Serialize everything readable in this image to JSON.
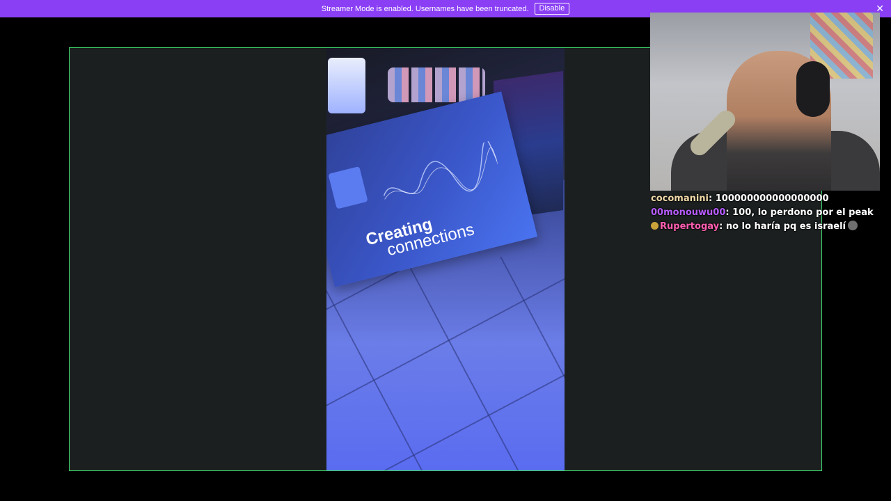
{
  "banner": {
    "message": "Streamer Mode is enabled. Usernames have been truncated.",
    "disable_label": "Disable",
    "close_icon": "close-icon",
    "background_color": "#8a3ff5"
  },
  "stream": {
    "frame_border_color": "#3fd66b",
    "video_card_line1": "Creating",
    "video_card_line2": "connections"
  },
  "chat": {
    "messages": [
      {
        "user": "cocomanini",
        "user_color": "#f0d9a8",
        "text": "100000000000000000",
        "badge": null
      },
      {
        "user": "00monouwu00",
        "user_color": "#b65cff",
        "text": "100, lo perdono por el peak",
        "badge": null
      },
      {
        "user": "Rupertogay",
        "user_color": "#ff5eb0",
        "text": "no lo haría pq es israelí",
        "badge": "badge-icon",
        "emote": "emote-icon"
      }
    ]
  }
}
